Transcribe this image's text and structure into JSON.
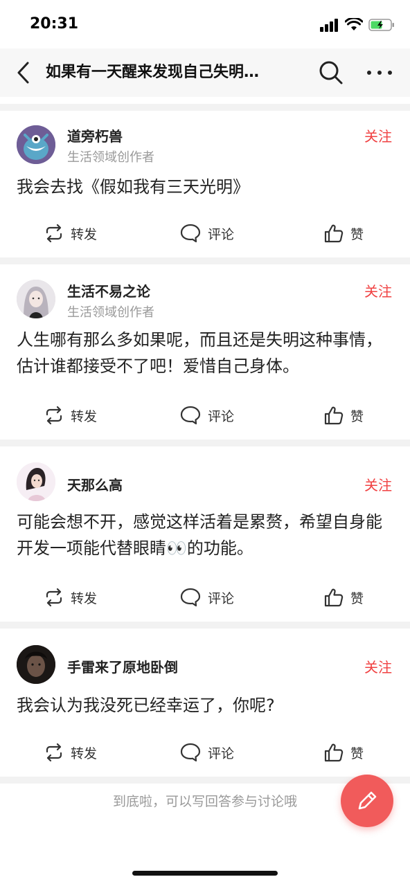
{
  "status_bar": {
    "time": "20:31"
  },
  "nav": {
    "title": "如果有一天醒来发现自己失明…"
  },
  "posts": [
    {
      "username": "道旁朽兽",
      "subtitle": "生活领域创作者",
      "follow": "关注",
      "content": "我会去找《假如我有三天光明》",
      "repost": "转发",
      "comment": "评论",
      "like": "赞"
    },
    {
      "username": "生活不易之论",
      "subtitle": "生活领域创作者",
      "follow": "关注",
      "content": "人生哪有那么多如果呢，而且还是失明这种事情，估计谁都接受不了吧！爱惜自己身体。",
      "repost": "转发",
      "comment": "评论",
      "like": "赞"
    },
    {
      "username": "天那么高",
      "follow": "关注",
      "content": "可能会想不开，感觉这样活着是累赘，希望自身能开发一项能代替眼睛👀的功能。",
      "repost": "转发",
      "comment": "评论",
      "like": "赞"
    },
    {
      "username": "手雷来了原地卧倒",
      "follow": "关注",
      "content": "我会认为我没死已经幸运了，你呢?",
      "repost": "转发",
      "comment": "评论",
      "like": "赞"
    }
  ],
  "bottom_hint": "到底啦，可以写回答参与讨论哦",
  "colors": {
    "accent": "#f04142",
    "fab": "#f15b5b",
    "separator": "#f2f2f2"
  },
  "icons": [
    "back-icon",
    "search-icon",
    "more-icon",
    "repost-icon",
    "comment-icon",
    "like-icon",
    "pencil-icon"
  ]
}
